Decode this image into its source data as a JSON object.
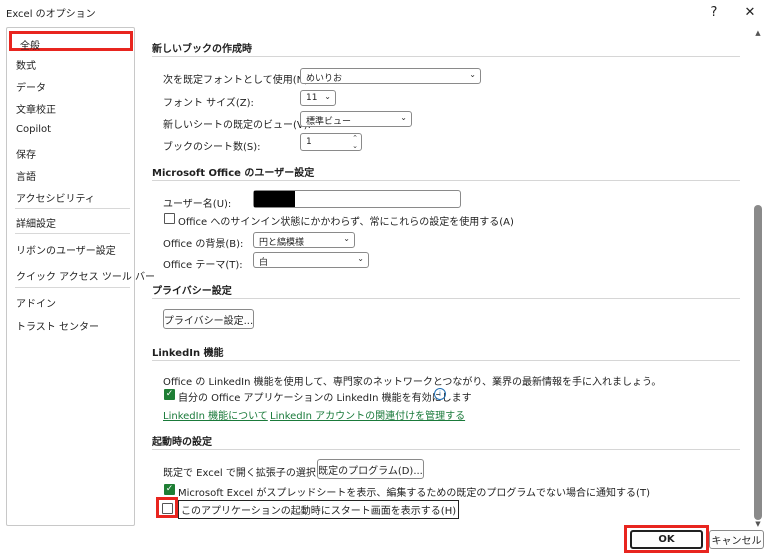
{
  "window": {
    "title": "Excel のオプション",
    "help": "?",
    "close": "✕"
  },
  "sidebar": {
    "items": [
      {
        "label": "全般"
      },
      {
        "label": "数式"
      },
      {
        "label": "データ"
      },
      {
        "label": "文章校正"
      },
      {
        "label": "Copilot"
      },
      {
        "label": "保存"
      },
      {
        "label": "言語"
      },
      {
        "label": "アクセシビリティ"
      },
      {
        "label": "詳細設定"
      },
      {
        "label": "リボンのユーザー設定"
      },
      {
        "label": "クイック アクセス ツール バー"
      },
      {
        "label": "アドイン"
      },
      {
        "label": "トラスト センター"
      }
    ]
  },
  "new_book": {
    "heading": "新しいブックの作成時",
    "font_label": "次を既定フォントとして使用(N):",
    "font_value": "めいりお",
    "size_label": "フォント サイズ(Z):",
    "size_value": "11",
    "view_label": "新しいシートの既定のビュー(V):",
    "view_value": "標準ビュー",
    "sheets_label": "ブックのシート数(S):",
    "sheets_value": "1"
  },
  "user_settings": {
    "heading": "Microsoft Office のユーザー設定",
    "username_label": "ユーザー名(U):",
    "always_use_label": "Office へのサインイン状態にかかわらず、常にこれらの設定を使用する(A)",
    "background_label": "Office の背景(B):",
    "background_value": "円と縞模様",
    "theme_label": "Office テーマ(T):",
    "theme_value": "白"
  },
  "privacy": {
    "heading": "プライバシー設定",
    "button": "プライバシー設定..."
  },
  "linkedin": {
    "heading": "LinkedIn 機能",
    "description": "Office の LinkedIn 機能を使用して、専門家のネットワークとつながり、業界の最新情報を手に入れましょう。",
    "enable_label": "自分の Office アプリケーションの LinkedIn 機能を有効にします",
    "link_about": "LinkedIn 機能について",
    "link_manage": "LinkedIn アカウントの関連付けを管理する"
  },
  "startup": {
    "heading": "起動時の設定",
    "ext_label": "既定で Excel で開く拡張子の選択:",
    "default_programs_button": "既定のプログラム(D)...",
    "notify_label": "Microsoft Excel がスプレッドシートを表示、編集するための既定のプログラムでない場合に通知する(T)",
    "show_start_label": "このアプリケーションの起動時にスタート画面を表示する(H)"
  },
  "footer": {
    "ok": "OK",
    "cancel": "キャンセル"
  },
  "colors": {
    "highlight": "#e8251f",
    "check_green": "#1e7e34",
    "link_green": "#1a7a3a"
  }
}
